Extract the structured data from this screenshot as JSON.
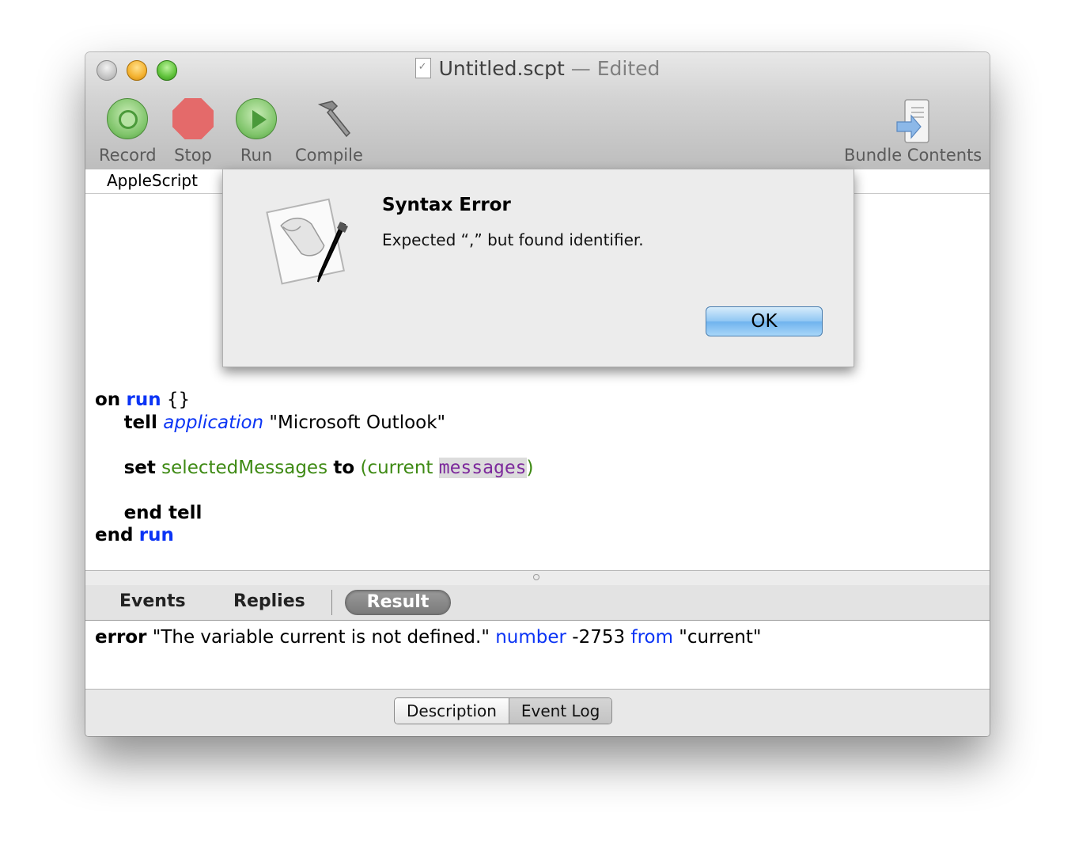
{
  "window": {
    "title": "Untitled.scpt",
    "title_sep": " — ",
    "title_status": "Edited"
  },
  "toolbar": {
    "record_label": "Record",
    "stop_label": "Stop",
    "run_label": "Run",
    "compile_label": "Compile",
    "bundle_label": "Bundle Contents"
  },
  "editor": {
    "language": "AppleScript"
  },
  "code": {
    "l1_kw": "on",
    "l1_run": "run",
    "l1_rest": " {}",
    "l2_kw": "tell",
    "l2_app": "application",
    "l2_str": " \"Microsoft Outlook\"",
    "l3_kw": "set",
    "l3_var": "selectedMessages",
    "l3_to": "to",
    "l3_open": "(current ",
    "l3_msg": "messages",
    "l3_close": ")",
    "l4_kw": "end tell",
    "l5_kw": "end",
    "l5_run": "run"
  },
  "result_tabs": {
    "events": "Events",
    "replies": "Replies",
    "result": "Result"
  },
  "result": {
    "kw": "error",
    "msg": " \"The variable current is not defined.\" ",
    "number_kw": "number",
    "number_val": " -2753 ",
    "from_kw": "from",
    "from_val": " \"current\""
  },
  "bottom": {
    "description": "Description",
    "event_log": "Event Log"
  },
  "alert": {
    "title": "Syntax Error",
    "message": "Expected “,” but found identifier.",
    "ok": "OK"
  }
}
